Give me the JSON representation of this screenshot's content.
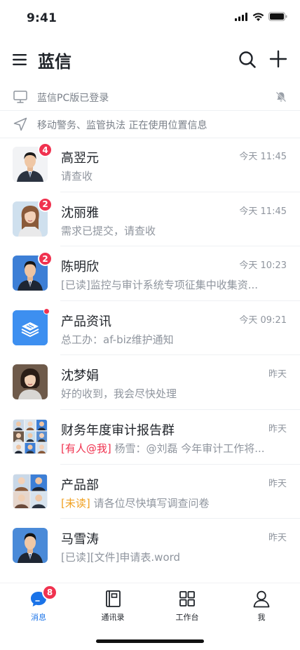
{
  "status_bar": {
    "time": "9:41"
  },
  "header": {
    "title": "蓝信"
  },
  "notices": [
    {
      "text": "蓝信PC版已登录"
    },
    {
      "text": "移动警务、监管执法 正在使用位置信息"
    }
  ],
  "chats": [
    {
      "name": "高翌元",
      "time": "今天 11:45",
      "preview": "请查收",
      "badge": "4"
    },
    {
      "name": "沈丽雅",
      "time": "今天 11:45",
      "preview": "需求已提交，请查收",
      "badge": "2"
    },
    {
      "name": "陈明欣",
      "time": "今天 10:23",
      "preview": "[已读]监控与审计系统专项征集中收集资...",
      "badge": "2"
    },
    {
      "name": "产品资讯",
      "time": "今天 09:21",
      "preview": "总工办：af-biz维护通知"
    },
    {
      "name": "沈梦娟",
      "time": "昨天",
      "preview": "好的收到，我会尽快处理"
    },
    {
      "name": "财务年度审计报告群",
      "time": "昨天",
      "tag": "[有人@我]",
      "preview": "杨雪：@刘磊 今年审计工作将..."
    },
    {
      "name": "产品部",
      "time": "昨天",
      "tag": "[未读]",
      "preview": "请各位尽快填写调查问卷"
    },
    {
      "name": "马雪涛",
      "time": "昨天",
      "preview": "[已读][文件]申请表.word"
    }
  ],
  "tabs": [
    {
      "label": "消息",
      "badge": "8"
    },
    {
      "label": "通讯录"
    },
    {
      "label": "工作台"
    },
    {
      "label": "我"
    }
  ],
  "colors": {
    "accent": "#1a73e8",
    "badge": "#f0324f",
    "unread_tag": "#f0a020"
  }
}
